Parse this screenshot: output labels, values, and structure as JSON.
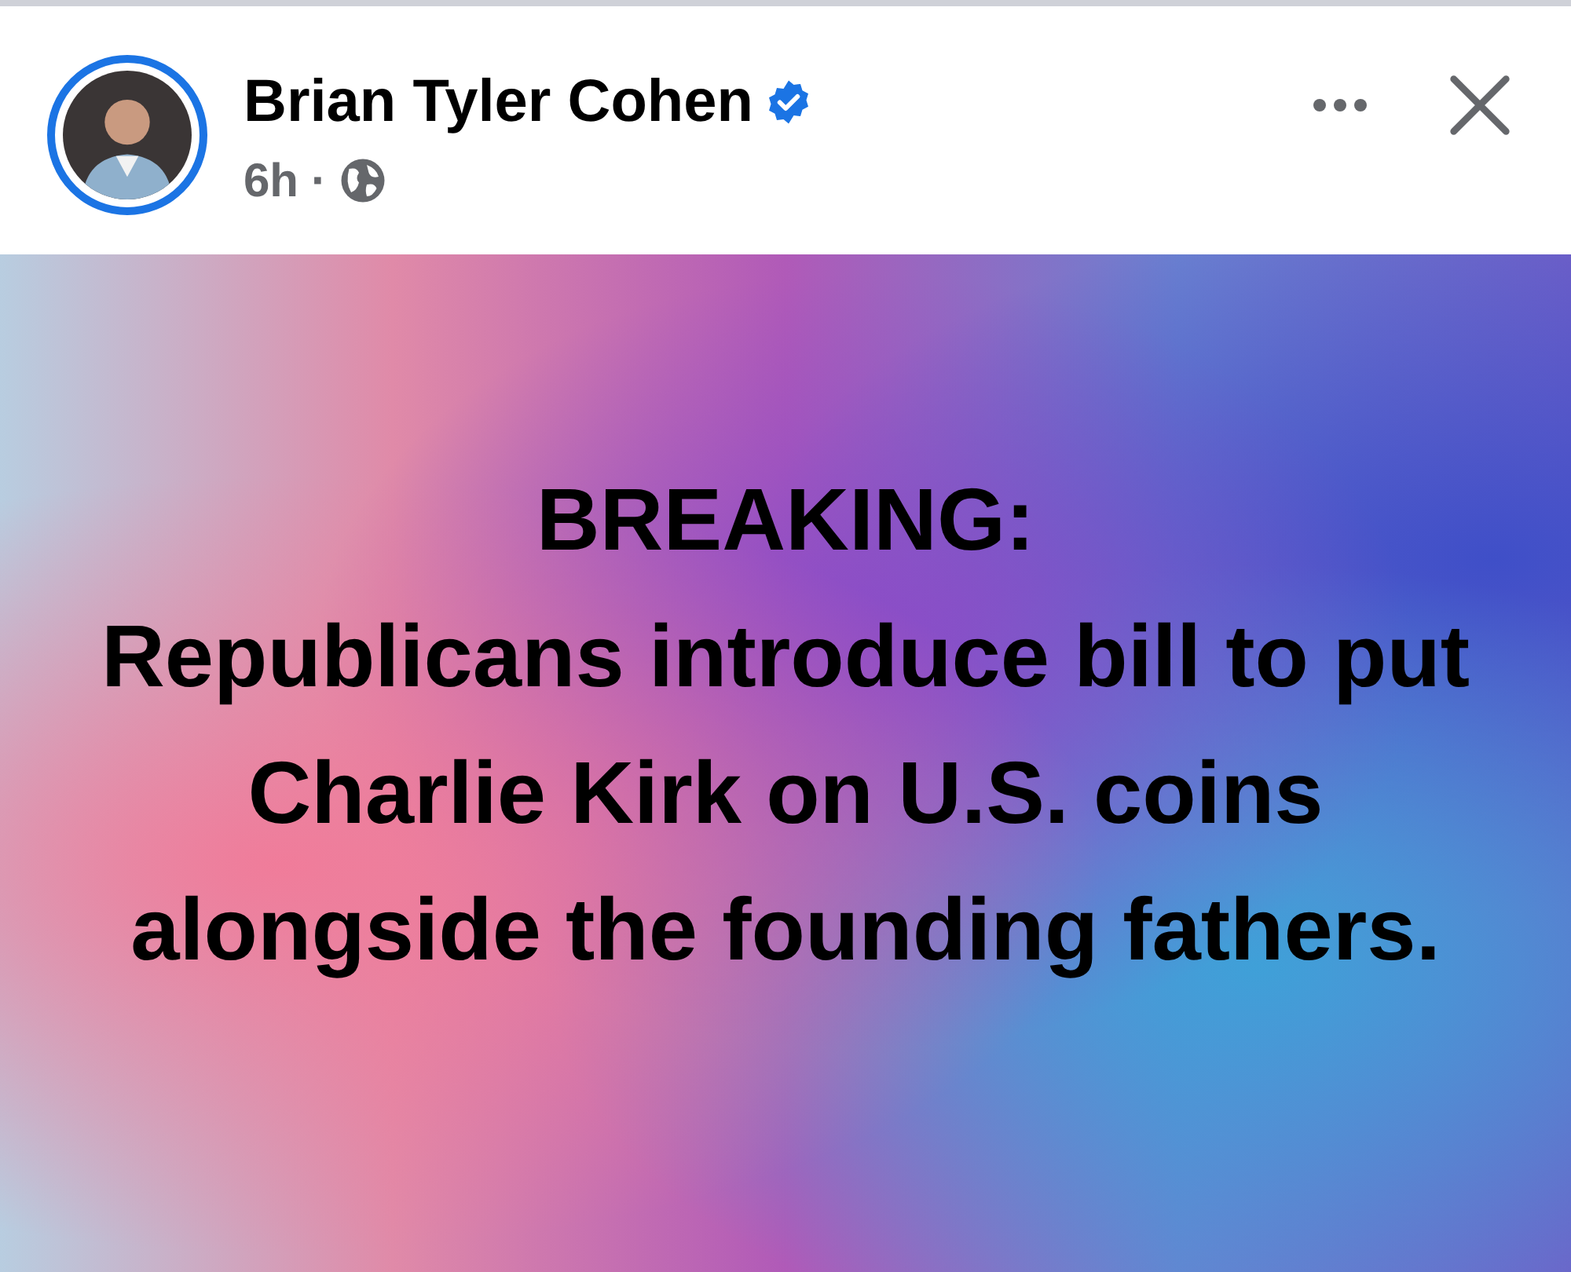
{
  "post": {
    "author": "Brian Tyler Cohen",
    "verified": true,
    "time": "6h",
    "separator": "·"
  },
  "content": {
    "headline": "BREAKING:",
    "body": "Republicans introduce bill to put Charlie Kirk on U.S. coins alongside the founding fathers."
  }
}
